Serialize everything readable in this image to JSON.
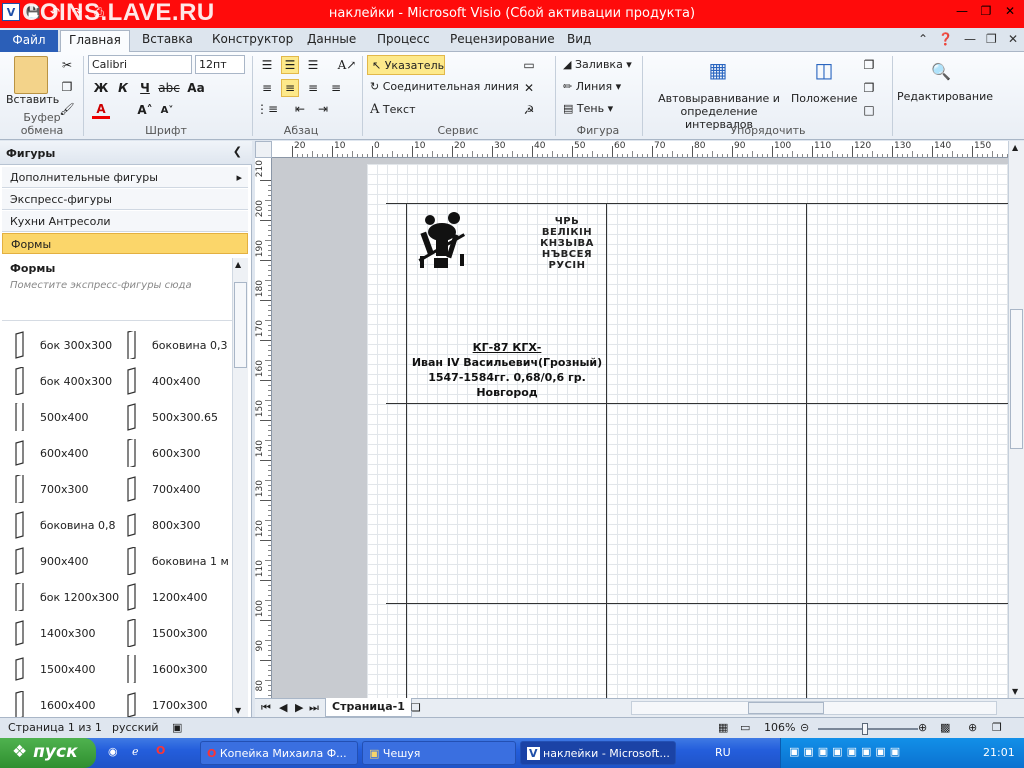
{
  "window": {
    "title": "наклейки  -  Microsoft Visio (Сбой активации продукта)",
    "watermark": "COINS.LAVE.RU"
  },
  "tabs": {
    "file": "Файл",
    "items": [
      "Главная",
      "Вставка",
      "Конструктор",
      "Данные",
      "Процесс",
      "Рецензирование",
      "Вид"
    ]
  },
  "ribbon": {
    "clipboard": {
      "paste": "Вставить",
      "label": "Буфер обмена"
    },
    "font": {
      "name": "Calibri",
      "size": "12пт",
      "label": "Шрифт"
    },
    "paragraph": {
      "label": "Абзац"
    },
    "tools": {
      "pointer": "Указатель",
      "connector": "Соединительная линия",
      "text": "Текст",
      "label": "Сервис"
    },
    "shape": {
      "fill": "Заливка",
      "line": "Линия",
      "shadow": "Тень",
      "label": "Фигура"
    },
    "arrange": {
      "auto_align": "Автовыравнивание и\nопределение интервалов",
      "position": "Положение",
      "label": "Упорядочить"
    },
    "editing": {
      "label": "Редактирование"
    }
  },
  "shapes_pane": {
    "title": "Фигуры",
    "stencils": [
      "Дополнительные фигуры",
      "Экспресс-фигуры",
      "Кухни Антресоли",
      "Формы"
    ],
    "section_title": "Формы",
    "hint": "Поместите экспресс-фигуры сюда",
    "items": [
      "бок 300х300",
      "боковина 0,3",
      "бок 400х300",
      "400х400",
      "500х400",
      "500х300.65",
      "600х400",
      "600х300",
      "700х300",
      "700х400",
      "боковина 0,8",
      "800х300",
      "900х400",
      "боковина 1 м",
      "бок 1200х300",
      "1200х400",
      "1400х300",
      "1500х300",
      "1500х400",
      "1600х300",
      "1600х400",
      "1700х300"
    ]
  },
  "rulers": {
    "h_ticks": [
      "20",
      "10",
      "0",
      "10",
      "20",
      "30",
      "40",
      "50",
      "60",
      "70",
      "80",
      "90",
      "100",
      "110",
      "120",
      "130",
      "140",
      "150"
    ],
    "v_ticks": [
      "210",
      "200",
      "190",
      "180",
      "170",
      "160",
      "150",
      "140",
      "130",
      "120",
      "110",
      "100",
      "90",
      "80"
    ]
  },
  "label": {
    "title": "КГ-87    КГХ-",
    "line1": "Иван IV Васильевич(Грозный)",
    "line2": "1547-1584гг. 0,68/0,6 гр.",
    "line3": "Новгород",
    "coin_text": "ЧРЬ\nВЕЛІКІН\nКНЗЬІВА\nНЪВСЕЯ\nРУСІН"
  },
  "page_tab": "Страница-1",
  "status": {
    "page": "Страница 1 из 1",
    "language": "русский",
    "zoom": "106%"
  },
  "taskbar": {
    "start": "пуск",
    "tasks": [
      "Копейка Михаила Ф...",
      "Чешуя",
      "наклейки - Microsoft..."
    ],
    "lang": "RU",
    "clock": "21:01"
  }
}
